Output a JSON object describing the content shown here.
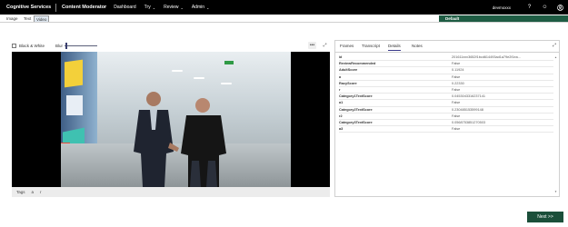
{
  "topbar": {
    "brand": "Cognitive Services",
    "product": "Content Moderator",
    "nav": [
      {
        "label": "Dashboard",
        "has_menu": false
      },
      {
        "label": "Try",
        "has_menu": true
      },
      {
        "label": "Review",
        "has_menu": true
      },
      {
        "label": "Admin",
        "has_menu": true
      }
    ],
    "user": "devmoxxx",
    "icons": [
      "help-icon",
      "smiley-icon",
      "account-icon"
    ]
  },
  "tabs": [
    "Image",
    "Text",
    "Video"
  ],
  "active_tab": "Video",
  "team_banner": "Default",
  "video_controls": {
    "black_white_label": "Black & White",
    "blur_label": "Blur",
    "more_label": "•••",
    "expand_label": "⤢"
  },
  "tags_bar": {
    "label": "Tags",
    "a": "a",
    "r": "r"
  },
  "panel_tabs": [
    "Frames",
    "Transcript",
    "Details",
    "Notes"
  ],
  "active_panel_tab": "Details",
  "details": [
    {
      "key": "id",
      "value": "201611xxx3652f1bcd614493ad1a79e2f1ea..."
    },
    {
      "key": "ReviewRecommended",
      "value": "False"
    },
    {
      "key": "AdultScore",
      "value": "0.11924"
    },
    {
      "key": "a",
      "value": "False"
    },
    {
      "key": "RacyScore",
      "value": "0.22330"
    },
    {
      "key": "r",
      "value": "False"
    },
    {
      "key": "Category1TextScore",
      "value": "0.0453043316237141"
    },
    {
      "key": "a1",
      "value": "False"
    },
    {
      "key": "Category2TextScore",
      "value": "0.230485153599148"
    },
    {
      "key": "r2",
      "value": "False"
    },
    {
      "key": "Category3TextScore",
      "value": "0.0568753851270503"
    },
    {
      "key": "a3",
      "value": "False"
    }
  ],
  "next_button": "Next >>",
  "colors": {
    "topbar": "#000000",
    "team_banner": "#1e5c43",
    "next_button": "#1b4f3a"
  }
}
